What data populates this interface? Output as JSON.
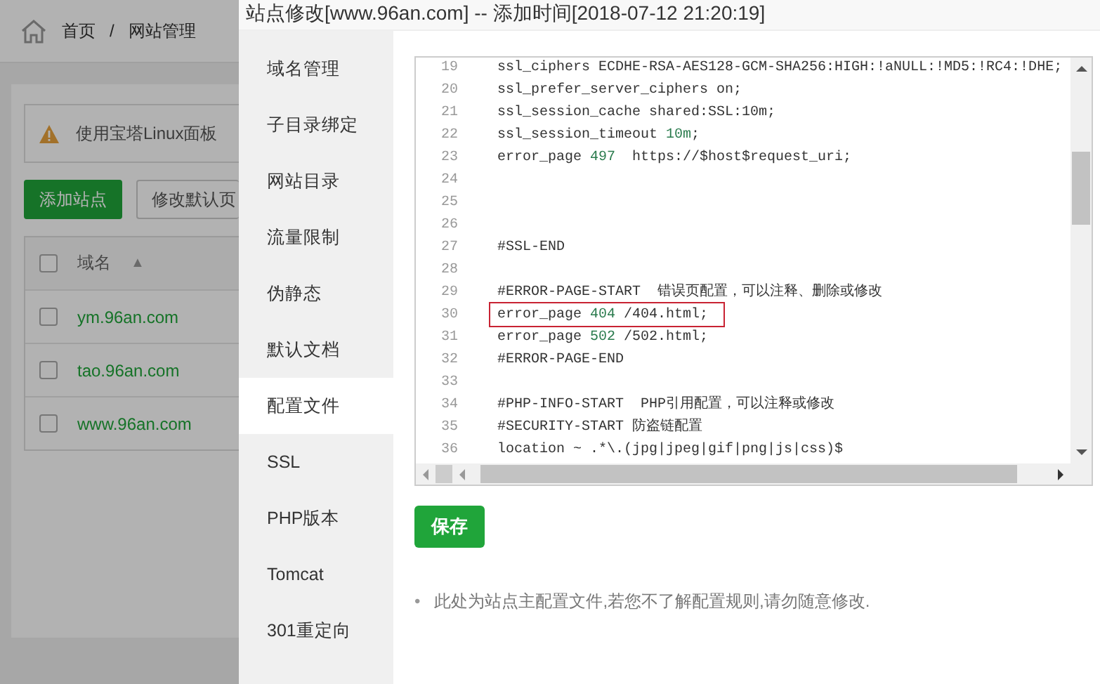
{
  "background": {
    "breadcrumb": [
      "首页",
      "/",
      "网站管理"
    ],
    "notice": "使用宝塔Linux面板",
    "buttons": [
      {
        "label": "添加站点",
        "kind": "primary"
      },
      {
        "label": "修改默认页",
        "kind": "plain"
      }
    ],
    "table": {
      "column": "域名",
      "sort": "▲",
      "checked": false,
      "rows": [
        {
          "domain": "ym.96an.com",
          "checked": false
        },
        {
          "domain": "tao.96an.com",
          "checked": false
        },
        {
          "domain": "www.96an.com",
          "checked": false
        }
      ]
    }
  },
  "dialog": {
    "title": "站点修改[www.96an.com] -- 添加时间[2018-07-12 21:20:19]",
    "menu": [
      {
        "label": "域名管理",
        "selected": false
      },
      {
        "label": "子目录绑定",
        "selected": false
      },
      {
        "label": "网站目录",
        "selected": false
      },
      {
        "label": "流量限制",
        "selected": false
      },
      {
        "label": "伪静态",
        "selected": false
      },
      {
        "label": "默认文档",
        "selected": false
      },
      {
        "label": "配置文件",
        "selected": true
      },
      {
        "label": "SSL",
        "selected": false
      },
      {
        "label": "PHP版本",
        "selected": false
      },
      {
        "label": "Tomcat",
        "selected": false
      },
      {
        "label": "301重定向",
        "selected": false
      }
    ],
    "editor": {
      "lines": [
        {
          "num": "19",
          "parts": [
            {
              "text": "ssl_ciphers ECDHE-RSA-AES128-GCM-SHA256:HIGH:!aNULL:!MD5:!RC4:!DHE;",
              "kind": "code"
            }
          ],
          "boxed": false
        },
        {
          "num": "20",
          "parts": [
            {
              "text": "ssl_prefer_server_ciphers on;",
              "kind": "code"
            }
          ],
          "boxed": false
        },
        {
          "num": "21",
          "parts": [
            {
              "text": "ssl_session_cache shared:SSL:10m;",
              "kind": "code"
            }
          ],
          "boxed": false
        },
        {
          "num": "22",
          "parts": [
            {
              "text": "ssl_session_timeout ",
              "kind": "code"
            },
            {
              "text": "10m",
              "kind": "number"
            },
            {
              "text": ";",
              "kind": "code"
            }
          ],
          "boxed": false
        },
        {
          "num": "23",
          "parts": [
            {
              "text": "error_page ",
              "kind": "code"
            },
            {
              "text": "497",
              "kind": "number"
            },
            {
              "text": "  https://$host$request_uri;",
              "kind": "code"
            }
          ],
          "boxed": false
        },
        {
          "num": "24",
          "boxed": false
        },
        {
          "num": "25",
          "boxed": false
        },
        {
          "num": "26",
          "boxed": false
        },
        {
          "num": "27",
          "parts": [
            {
              "text": "#SSL-END",
              "kind": "code"
            }
          ],
          "boxed": false
        },
        {
          "num": "28",
          "boxed": false
        },
        {
          "num": "29",
          "parts": [
            {
              "text": "#ERROR-PAGE-START  错误页配置，可以注释、删除或修改",
              "kind": "code"
            }
          ],
          "boxed": false
        },
        {
          "num": "30",
          "parts": [
            {
              "text": "error_page ",
              "kind": "code"
            },
            {
              "text": "404",
              "kind": "number"
            },
            {
              "text": " /404.html;",
              "kind": "code"
            }
          ],
          "boxed": true
        },
        {
          "num": "31",
          "parts": [
            {
              "text": "error_page ",
              "kind": "code"
            },
            {
              "text": "502",
              "kind": "number"
            },
            {
              "text": " /502.html;",
              "kind": "code"
            }
          ],
          "boxed": false
        },
        {
          "num": "32",
          "parts": [
            {
              "text": "#ERROR-PAGE-END",
              "kind": "code"
            }
          ],
          "boxed": false
        },
        {
          "num": "33",
          "boxed": false
        },
        {
          "num": "34",
          "parts": [
            {
              "text": "#PHP-INFO-START  PHP引用配置，可以注释或修改",
              "kind": "code"
            }
          ],
          "boxed": false
        },
        {
          "num": "35",
          "parts": [
            {
              "text": "#SECURITY-START 防盗链配置",
              "kind": "code"
            }
          ],
          "boxed": false
        },
        {
          "num": "36",
          "parts": [
            {
              "text": "location ~ .*\\.(jpg|jpeg|gif|png|js|css)$",
              "kind": "code"
            }
          ],
          "boxed": false
        }
      ]
    },
    "save": "保存",
    "tips": [
      {
        "bullet": "•",
        "text": "此处为站点主配置文件,若您不了解配置规则,请勿随意修改."
      }
    ]
  }
}
